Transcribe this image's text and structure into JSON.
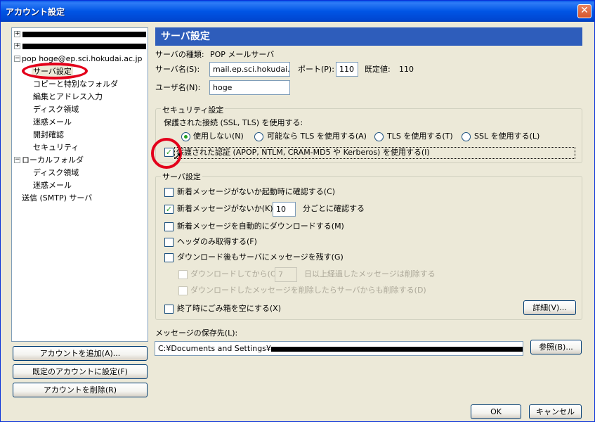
{
  "window": {
    "title": "アカウント設定",
    "close": "✕"
  },
  "tree": {
    "plus": "+",
    "minus": "−",
    "account": "pop hoge@ep.sci.hokudai.ac.jp",
    "items": [
      "サーバ設定",
      "コピーと特別なフォルダ",
      "編集とアドレス入力",
      "ディスク領域",
      "迷惑メール",
      "開封確認",
      "セキュリティ"
    ],
    "local": "ローカルフォルダ",
    "local_items": [
      "ディスク領域",
      "迷惑メール"
    ],
    "smtp": "送信 (SMTP) サーバ"
  },
  "left_buttons": {
    "add": "アカウントを追加(A)...",
    "default": "既定のアカウントに設定(F)",
    "remove": "アカウントを削除(R)"
  },
  "panel": {
    "title": "サーバ設定",
    "server_type_label": "サーバの種類:",
    "server_type": "POP メールサーバ",
    "server_name_label": "サーバ名(S):",
    "server_name": "mail.ep.sci.hokudai.ac.",
    "port_label": "ポート(P):",
    "port": "110",
    "default_label": "既定値:",
    "default_value": "110",
    "user_label": "ユーザ名(N):",
    "user": "hoge"
  },
  "security": {
    "legend": "セキュリティ設定",
    "conn_label": "保護された接続 (SSL, TLS) を使用する:",
    "options": [
      "使用しない(N)",
      "可能なら TLS を使用する(A)",
      "TLS を使用する(T)",
      "SSL を使用する(L)"
    ],
    "secure_auth": "保護された認証 (APOP, NTLM, CRAM-MD5 や Kerberos) を使用する(I)",
    "check": "✓"
  },
  "server": {
    "legend": "サーバ設定",
    "check_startup": "新着メッセージがないか起動時に確認する(C)",
    "check_every": "新着メッセージがないか(K)",
    "minutes": "10",
    "minutes_suffix": "分ごとに確認する",
    "auto_download": "新着メッセージを自動的にダウンロードする(M)",
    "headers_only": "ヘッダのみ取得する(F)",
    "leave_on_server": "ダウンロード後もサーバにメッセージを残す(G)",
    "delete_after_prefix": "ダウンロードしてから(O)",
    "days": "7",
    "delete_after_suffix": "日以上経過したメッセージは削除する",
    "delete_sync": "ダウンロードしたメッセージを削除したらサーバからも削除する(D)",
    "empty_trash": "終了時にごみ箱を空にする(X)",
    "advanced": "詳細(V)..."
  },
  "storage": {
    "label": "メッセージの保存先(L):",
    "path": "C:¥Documents and Settings¥",
    "browse": "参照(B)..."
  },
  "footer": {
    "ok": "OK",
    "cancel": "キャンセル"
  }
}
